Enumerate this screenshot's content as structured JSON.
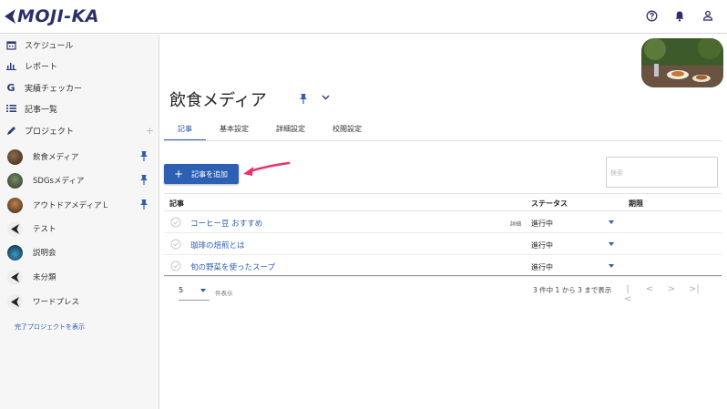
{
  "header": {
    "logo_text": "MOJI-KA",
    "icons": [
      "help-circle-icon",
      "bell-icon",
      "user-icon"
    ]
  },
  "sidebar": {
    "nav": [
      {
        "label": "スケジュール",
        "icon": "calendar-icon"
      },
      {
        "label": "レポート",
        "icon": "bar-chart-icon"
      },
      {
        "label": "実績チェッカー",
        "icon": "google-g-icon"
      },
      {
        "label": "記事一覧",
        "icon": "list-icon"
      },
      {
        "label": "プロジェクト",
        "icon": "pen-icon"
      }
    ],
    "projects": [
      {
        "label": "飲食メディア",
        "pinned": true
      },
      {
        "label": "SDGsメディア",
        "pinned": true
      },
      {
        "label": "アウトドアメディアＬ",
        "pinned": true
      },
      {
        "label": "テスト",
        "pinned": false
      },
      {
        "label": "説明会",
        "pinned": false
      },
      {
        "label": "未分類",
        "pinned": false
      },
      {
        "label": "ワードプレス",
        "pinned": false
      }
    ],
    "show_completed": "完了プロジェクトを表示"
  },
  "main": {
    "title": "飲食メディア",
    "tabs": [
      {
        "label": "記事",
        "active": true
      },
      {
        "label": "基本設定",
        "active": false
      },
      {
        "label": "詳細設定",
        "active": false
      },
      {
        "label": "校閲設定",
        "active": false
      }
    ],
    "add_button": "記事を追加",
    "search_placeholder": "検索",
    "table": {
      "headers": {
        "article": "記事",
        "status": "ステータス",
        "deadline": "期限"
      },
      "rows": [
        {
          "title": "コーヒー豆 おすすめ",
          "detail": "詳細",
          "status": "進行中"
        },
        {
          "title": "珈琲の焙煎とは",
          "detail": "",
          "status": "進行中"
        },
        {
          "title": "旬の野菜を使ったスープ",
          "detail": "",
          "status": "進行中"
        }
      ]
    },
    "pagination": {
      "per_page": "5",
      "per_page_label": "件表示",
      "range_text": "3 件中 1 から 3 まで表示"
    }
  },
  "colors": {
    "accent": "#2d60b3",
    "arrow": "#e8336b",
    "logo": "#2b2f6b"
  }
}
